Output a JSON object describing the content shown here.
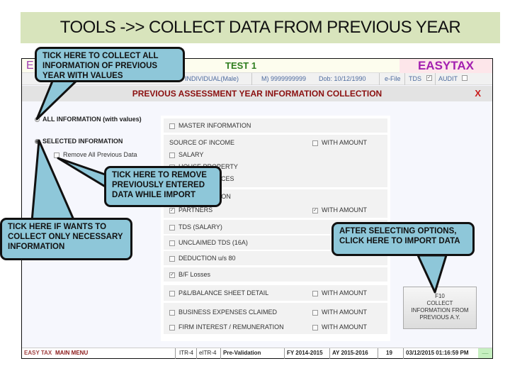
{
  "slide": {
    "title": "TOOLS ->> COLLECT DATA FROM PREVIOUS YEAR"
  },
  "app": {
    "brand_left": "E",
    "client_name": "TEST 1",
    "brand_right": "EASYTAX",
    "info_bar": {
      "status": "Status : INDIVIDUAL(Male)",
      "mobile": "M) 9999999999",
      "dob": "Dob: 10/12/1990",
      "efile": "e-File",
      "tds_label": "TDS",
      "tds_checked": true,
      "audit_label": "AUDIT",
      "audit_checked": false
    },
    "section_title": "PREVIOUS ASSESSMENT YEAR INFORMATION COLLECTION",
    "close_label": "X",
    "radio_options": [
      {
        "label": "ALL INFORMATION (with values)",
        "selected": false
      },
      {
        "label": "SELECTED INFORMATION",
        "selected": true
      }
    ],
    "remove_previous": {
      "label": "Remove All Previous Data",
      "checked": false
    },
    "options": {
      "master_information": {
        "label": "MASTER INFORMATION",
        "checked": false
      },
      "source_of_income": {
        "label": "SOURCE OF INCOME",
        "with_amount": {
          "label": "WITH AMOUNT",
          "checked": false
        },
        "items": [
          {
            "label": "SALARY",
            "checked": false
          },
          {
            "label": "HOUSE PROPERTY",
            "checked": false
          },
          {
            "label": "OTHER SOURCES",
            "checked": false
          }
        ]
      },
      "firm_information": {
        "label": "FIRM INFORMATION",
        "items": [
          {
            "label": "PARTNERS",
            "checked": true
          }
        ],
        "with_amount": {
          "label": "WITH AMOUNT",
          "checked": true
        }
      },
      "tds_salary": {
        "label": "TDS (SALARY)",
        "checked": false
      },
      "unclaimed_tds": {
        "label": "UNCLAIMED TDS (16A)",
        "checked": false
      },
      "deduction": {
        "label": "DEDUCTION u/s 80",
        "checked": false
      },
      "bf_losses": {
        "label": "B/F Losses",
        "checked": true
      },
      "pl_balance": {
        "label": "P&L/BALANCE SHEET DETAIL",
        "checked": false,
        "with_amount": {
          "label": "WITH AMOUNT",
          "checked": false
        }
      },
      "business_expenses": {
        "label": "BUSINESS EXPENSES CLAIMED",
        "checked": false,
        "with_amount": {
          "label": "WITH AMOUNT",
          "checked": false
        }
      },
      "firm_interest": {
        "label": "FIRM INTEREST / REMUNERATION",
        "checked": false,
        "with_amount": {
          "label": "WITH AMOUNT",
          "checked": false
        }
      }
    },
    "collect_button": {
      "line1": "F10",
      "line2": "COLLECT",
      "line3": "INFORMATION FROM",
      "line4": "PREVIOUS A.Y."
    },
    "status_bar": {
      "menu_part1": "EASY TAX",
      "menu_part2": "MAIN MENU",
      "itr": "ITR-4",
      "eitr": "eITR-4",
      "prevalidation": "Pre-Validation",
      "fy": "FY 2014-2015",
      "ay": "AY 2015-2016",
      "count": "19",
      "datetime": "03/12/2015 01:16:59 PM",
      "indicator": "__"
    }
  },
  "callouts": {
    "all_info": "TICK HERE TO COLLECT ALL INFORMATION OF PREVIOUS YEAR WITH VALUES",
    "remove": "TICK HERE TO REMOVE PREVIOUSLY ENTERED DATA WHILE IMPORT",
    "selected": "TICK HERE IF WANTS TO COLLECT ONLY NECESSARY INFORMATION",
    "after": "AFTER SELECTING OPTIONS, CLICK HERE TO IMPORT DATA"
  }
}
